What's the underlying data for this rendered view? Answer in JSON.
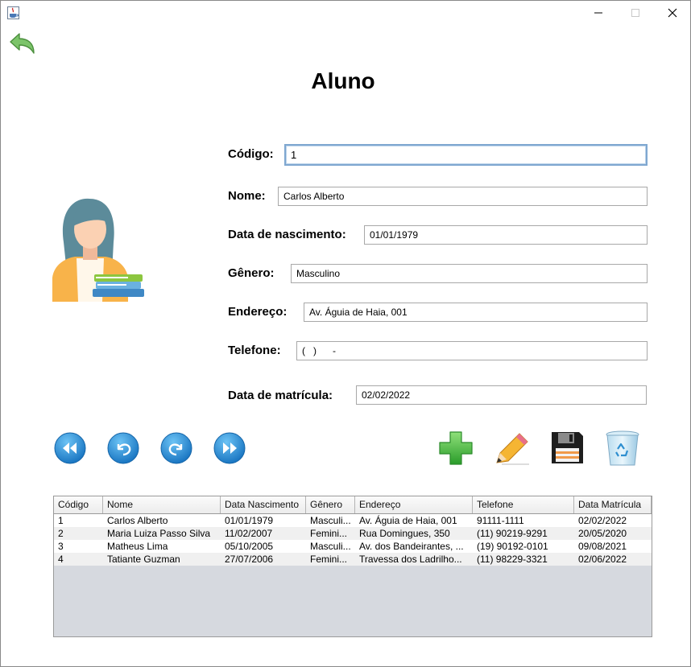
{
  "window": {
    "icon": "java-coffee-icon",
    "controls": [
      "minimize-icon",
      "maximize-icon",
      "close-icon"
    ]
  },
  "title": "Aluno",
  "form": {
    "codigo": {
      "label": "Código:",
      "value": "1"
    },
    "nome": {
      "label": "Nome:",
      "value": "Carlos Alberto"
    },
    "nascimento": {
      "label": "Data de nascimento:",
      "value": "01/01/1979"
    },
    "genero": {
      "label": "Gênero:",
      "value": "Masculino"
    },
    "endereco": {
      "label": "Endereço:",
      "value": "Av. Águia de Haia, 001"
    },
    "telefone": {
      "label": "Telefone:",
      "value": "(   )      -"
    },
    "matricula": {
      "label": "Data de matrícula:",
      "value": "02/02/2022"
    }
  },
  "navigation": [
    "first-record-icon",
    "previous-record-icon",
    "next-record-icon",
    "last-record-icon"
  ],
  "actions": [
    "add-icon",
    "edit-pencil-icon",
    "save-floppy-icon",
    "delete-recycle-bin-icon"
  ],
  "colors": {
    "nav_blue": "#2a8fd6",
    "add_green": "#39b54a",
    "back_green": "#5aa84a"
  },
  "table": {
    "columns": [
      "Código",
      "Nome",
      "Data Nascimento",
      "Gênero",
      "Endereço",
      "Telefone",
      "Data Matrícula"
    ],
    "rows": [
      [
        "1",
        "Carlos Alberto",
        "01/01/1979",
        "Masculi...",
        "Av. Águia de Haia, 001",
        "91111-1111",
        "02/02/2022"
      ],
      [
        "2",
        "Maria Luiza Passo Silva",
        "11/02/2007",
        "Femini...",
        "Rua Domingues, 350",
        "(11) 90219-9291",
        "20/05/2020"
      ],
      [
        "3",
        "Matheus Lima",
        "05/10/2005",
        "Masculi...",
        "Av. dos Bandeirantes, ...",
        "(19) 90192-0101",
        "09/08/2021"
      ],
      [
        "4",
        "Tatiante Guzman",
        "27/07/2006",
        "Femini...",
        "Travessa dos Ladrilho...",
        "(11) 98229-3321",
        "02/06/2022"
      ]
    ]
  }
}
